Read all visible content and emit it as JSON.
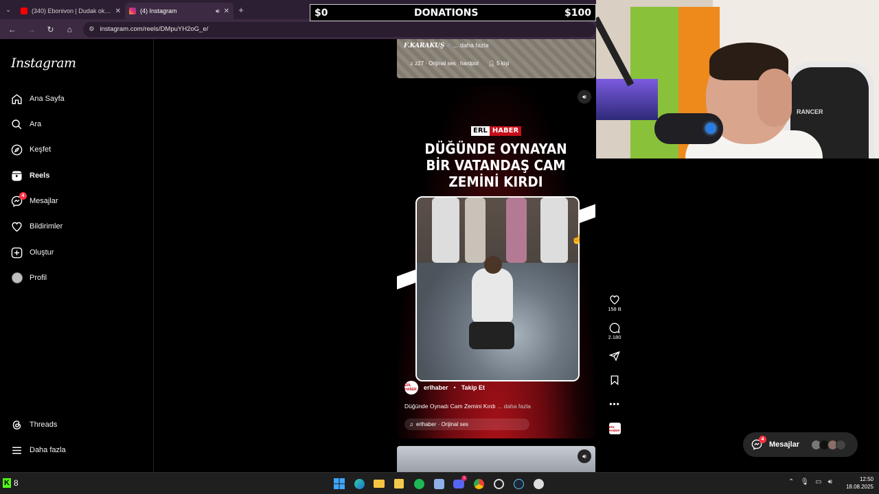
{
  "browser": {
    "tabs": [
      {
        "title": "(340) Ebonivon | Dudak okuma",
        "favicon_color": "#ff0000"
      },
      {
        "title": "(4) Instagram",
        "favicon_color": "#e1306c"
      }
    ],
    "url": "instagram.com/reels/DMpuYH2oG_e/"
  },
  "donations": {
    "left": "$0",
    "center": "DONATIONS",
    "right": "$100"
  },
  "sidebar": {
    "logo": "Instagram",
    "items": [
      {
        "label": "Ana Sayfa",
        "icon": "home-icon"
      },
      {
        "label": "Ara",
        "icon": "search-icon"
      },
      {
        "label": "Keşfet",
        "icon": "compass-icon"
      },
      {
        "label": "Reels",
        "icon": "reels-icon"
      },
      {
        "label": "Mesajlar",
        "icon": "messenger-icon",
        "badge": "4"
      },
      {
        "label": "Bildirimler",
        "icon": "heart-icon"
      },
      {
        "label": "Oluştur",
        "icon": "plus-square-icon"
      },
      {
        "label": "Profil",
        "icon": "avatar"
      }
    ],
    "bottom": [
      {
        "label": "Threads",
        "icon": "threads-icon"
      },
      {
        "label": "Daha fazla",
        "icon": "menu-icon"
      }
    ]
  },
  "reel_prev": {
    "user": "F.KARAKUŞ",
    "more": "... daha fazla",
    "audio": "z27 · Orijinal ses",
    "audio_user": "hardpol",
    "people": "5 kişi"
  },
  "reel": {
    "brand_a": "ERL",
    "brand_b": "HABER",
    "headline": "DÜĞÜNDE OYNAYAN BİR VATANDAŞ CAM ZEMİNİ KIRDI",
    "username": "erlhaber",
    "follow": "Takip Et",
    "caption": "Düğünde Oynadı Cam Zemini Kırdı",
    "more": "... daha fazla",
    "audio": "erlhaber · Orijinal ses",
    "likes": "158 B",
    "comments": "2.180",
    "avatar_text": "ERL HABER"
  },
  "messages_pill": {
    "label": "Mesajlar",
    "badge": "4"
  },
  "webcam": {
    "chair_text": "RANCER"
  },
  "taskbar": {
    "kick_count": "8",
    "discord_badge": "1",
    "time": "12:50",
    "date": "18.08.2025"
  }
}
